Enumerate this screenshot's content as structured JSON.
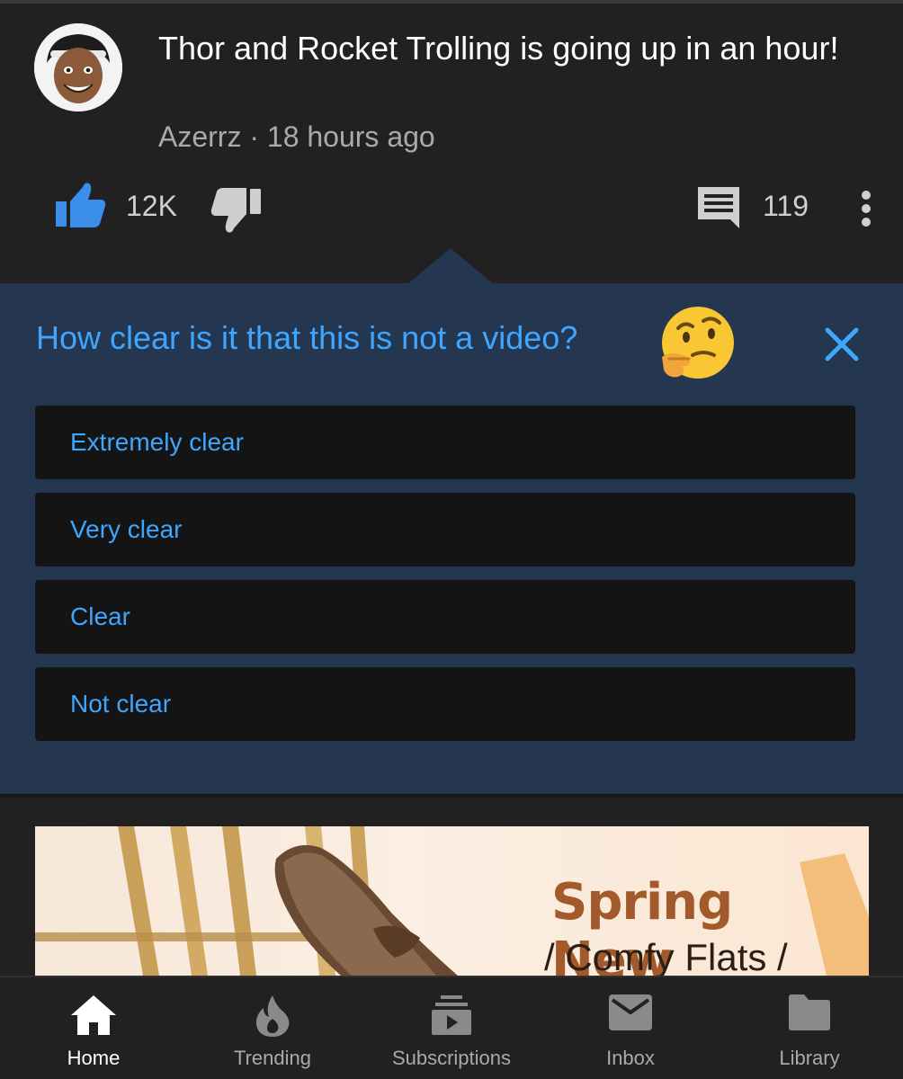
{
  "post": {
    "title": "Thor and Rocket Trolling is going up in an hour!",
    "author": "Azerrz",
    "separator": "·",
    "time": "18 hours ago",
    "likes": "12K",
    "comments": "119"
  },
  "survey": {
    "question": "How clear is it that this is not a video?",
    "options": [
      "Extremely clear",
      "Very clear",
      "Clear",
      "Not clear"
    ]
  },
  "ad": {
    "headline": "Spring New",
    "subline": "/ Comfy Flats /"
  },
  "nav": {
    "items": [
      {
        "label": "Home",
        "icon": "home-icon",
        "active": true
      },
      {
        "label": "Trending",
        "icon": "fire-icon"
      },
      {
        "label": "Subscriptions",
        "icon": "subscriptions-icon"
      },
      {
        "label": "Inbox",
        "icon": "mail-icon"
      },
      {
        "label": "Library",
        "icon": "folder-icon"
      }
    ]
  },
  "colors": {
    "accent": "#3ea6ff",
    "like": "#3b8eea",
    "panel": "#253650",
    "background": "#212121"
  }
}
